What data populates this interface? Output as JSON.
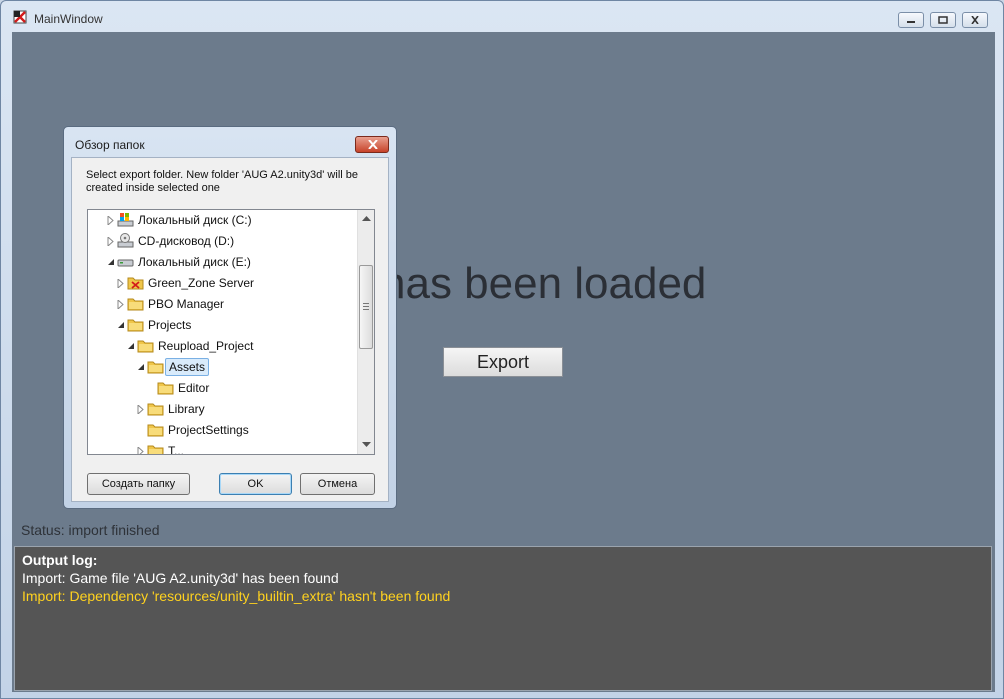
{
  "window": {
    "title": "MainWindow"
  },
  "main": {
    "loaded_text": "has been loaded",
    "export_label": "Export",
    "status": "Status: import finished"
  },
  "log": {
    "title": "Output log:",
    "lines": [
      {
        "text": "Import: Game file 'AUG A2.unity3d' has been found",
        "level": "info"
      },
      {
        "text": "Import: Dependency 'resources/unity_builtin_extra' hasn't been found",
        "level": "warning"
      }
    ]
  },
  "dialog": {
    "title": "Обзор папок",
    "description": "Select export folder. New folder 'AUG A2.unity3d' will be created inside selected one",
    "tree": [
      {
        "label": "Локальный диск (C:)",
        "icon": "hard-drive-icon"
      },
      {
        "label": "CD-дисковод (D:)",
        "icon": "cd-drive-icon"
      },
      {
        "label": "Локальный диск (E:)",
        "icon": "hard-drive-icon"
      },
      {
        "label": "Green_Zone Server",
        "icon": "folder-shortcut-icon"
      },
      {
        "label": "PBO Manager",
        "icon": "folder-icon"
      },
      {
        "label": "Projects",
        "icon": "folder-icon"
      },
      {
        "label": "Reupload_Project",
        "icon": "folder-icon"
      },
      {
        "label": "Assets",
        "icon": "folder-icon",
        "selected": true
      },
      {
        "label": "Editor",
        "icon": "folder-icon"
      },
      {
        "label": "Library",
        "icon": "folder-icon"
      },
      {
        "label": "ProjectSettings",
        "icon": "folder-icon"
      },
      {
        "label": "T...",
        "icon": "folder-icon"
      }
    ],
    "buttons": {
      "new_folder": "Создать папку",
      "ok": "OK",
      "cancel": "Отмена"
    }
  },
  "colors": {
    "client_bg": "#6c7b8c",
    "log_bg": "#555555",
    "warning": "#ffd21f",
    "selection": "#d9ebfb"
  }
}
